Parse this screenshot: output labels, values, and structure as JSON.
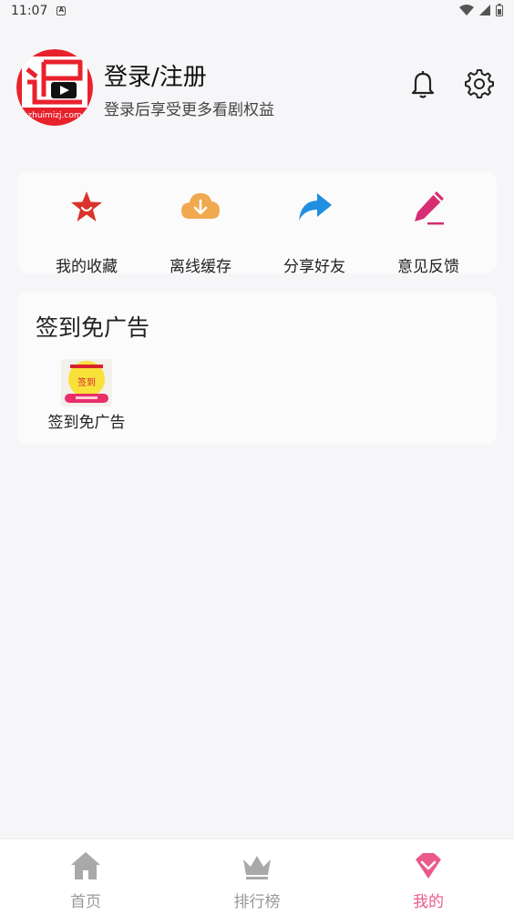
{
  "status_bar": {
    "time": "11:07",
    "notification_icon": "a-icon"
  },
  "profile": {
    "avatar_icon": "app-logo-avatar",
    "title": "登录/注册",
    "subtitle": "登录后享受更多看剧权益"
  },
  "header_icons": [
    "bell-icon",
    "gear-icon"
  ],
  "quick_actions": [
    {
      "label": "我的收藏",
      "icon": "star-icon",
      "color": "#d9332b"
    },
    {
      "label": "离线缓存",
      "icon": "cloud-download-icon",
      "color": "#f0a94e"
    },
    {
      "label": "分享好友",
      "icon": "share-arrow-icon",
      "color": "#1f8fe0"
    },
    {
      "label": "意见反馈",
      "icon": "pencil-icon",
      "color": "#d62d73"
    }
  ],
  "signin_section": {
    "title": "签到免广告",
    "tile": {
      "label": "签到免广告",
      "thumb_text": "签到"
    }
  },
  "tabs": [
    {
      "label": "首页",
      "icon": "home-icon",
      "active": false
    },
    {
      "label": "排行榜",
      "icon": "crown-icon",
      "active": false
    },
    {
      "label": "我的",
      "icon": "diamond-icon",
      "active": true
    }
  ],
  "colors": {
    "accent": "#ea5a8c",
    "inactive_tab": "#999999",
    "background": "#f6f5f7"
  }
}
